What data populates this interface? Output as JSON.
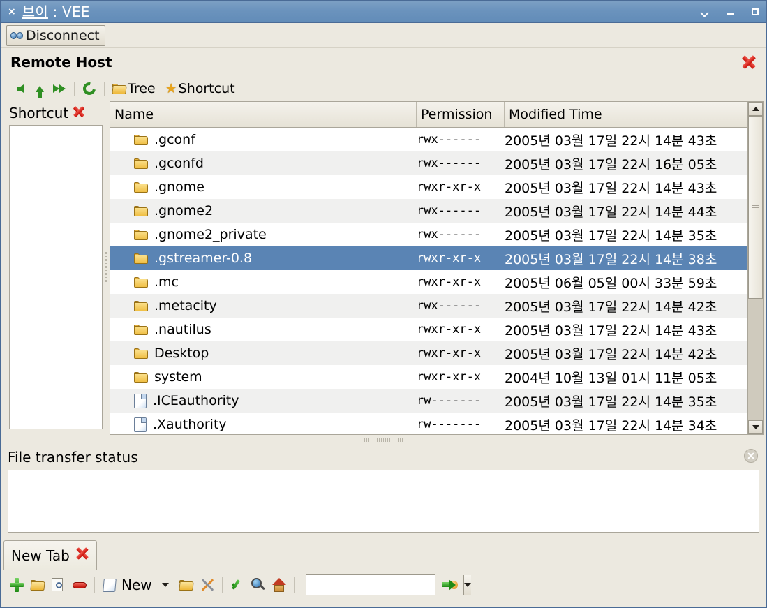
{
  "window": {
    "title_mnemonic": "브이",
    "title_rest": " : VEE",
    "close_glyph": "×",
    "controls": {
      "menu": "chevron-down",
      "minimize": "minimize",
      "maximize": "maximize"
    }
  },
  "toolbar": {
    "disconnect_label": "Disconnect"
  },
  "remote_host": {
    "title": "Remote Host"
  },
  "navbar": {
    "back": "back-arrow",
    "up": "up-arrow",
    "forward": "forward-double-arrow",
    "refresh": "refresh-arrows",
    "tree_label": "Tree",
    "shortcut_label": "Shortcut"
  },
  "shortcut_pane": {
    "title": "Shortcut",
    "items": []
  },
  "file_list": {
    "columns": [
      "Name",
      "Permission",
      "Modified Time"
    ],
    "selected_index": 5,
    "rows": [
      {
        "name": ".gconf",
        "type": "folder",
        "permission": "rwx------",
        "modified": "2005년 03월 17일 22시 14분 43초"
      },
      {
        "name": ".gconfd",
        "type": "folder",
        "permission": "rwx------",
        "modified": "2005년 03월 17일 22시 16분 05초"
      },
      {
        "name": ".gnome",
        "type": "folder",
        "permission": "rwxr-xr-x",
        "modified": "2005년 03월 17일 22시 14분 43초"
      },
      {
        "name": ".gnome2",
        "type": "folder",
        "permission": "rwx------",
        "modified": "2005년 03월 17일 22시 14분 44초"
      },
      {
        "name": ".gnome2_private",
        "type": "folder",
        "permission": "rwx------",
        "modified": "2005년 03월 17일 22시 14분 35초"
      },
      {
        "name": ".gstreamer-0.8",
        "type": "folder",
        "permission": "rwxr-xr-x",
        "modified": "2005년 03월 17일 22시 14분 38초"
      },
      {
        "name": ".mc",
        "type": "folder",
        "permission": "rwxr-xr-x",
        "modified": "2005년 06월 05일 00시 33분 59초"
      },
      {
        "name": ".metacity",
        "type": "folder",
        "permission": "rwx------",
        "modified": "2005년 03월 17일 22시 14분 42초"
      },
      {
        "name": ".nautilus",
        "type": "folder",
        "permission": "rwxr-xr-x",
        "modified": "2005년 03월 17일 22시 14분 43초"
      },
      {
        "name": "Desktop",
        "type": "folder",
        "permission": "rwxr-xr-x",
        "modified": "2005년 03월 17일 22시 14분 42초"
      },
      {
        "name": "system",
        "type": "folder",
        "permission": "rwxr-xr-x",
        "modified": "2004년 10월 13일 01시 11분 05초"
      },
      {
        "name": ".ICEauthority",
        "type": "file",
        "permission": "rw-------",
        "modified": "2005년 03월 17일 22시 14분 35초"
      },
      {
        "name": ".Xauthority",
        "type": "file",
        "permission": "rw-------",
        "modified": "2005년 03월 17일 22시 14분 34초"
      }
    ]
  },
  "status_panel": {
    "title": "File transfer status",
    "content": ""
  },
  "tabs": [
    {
      "label": "New Tab",
      "close_icon": "close-x-icon"
    }
  ],
  "bottom_toolbar": {
    "add": "add-plus-icon",
    "open_folder": "open-folder-icon",
    "preview": "page-search-icon",
    "remove": "remove-minus-icon",
    "new_label": "New",
    "new_doc": "document-icon",
    "new_dropdown": "chevron-down-icon",
    "folder": "folder-icon",
    "tools": "tools-icon",
    "confirm": "check-icon",
    "search_web": "globe-search-icon",
    "home": "home-icon",
    "command_value": "",
    "command_placeholder": "",
    "combo_arrow": "chevron-down-icon",
    "go": "go-arrow-icon"
  },
  "scrollbar": {
    "up": "scroll-up-arrow",
    "down": "scroll-down-arrow",
    "thumb_pct": 60
  },
  "colors": {
    "titlebar": "#6b93bd",
    "selection": "#5a84b4",
    "face": "#ece9e0",
    "row_alt": "#f0f0ef",
    "accent_red": "#c81008",
    "accent_green": "#1f8a14"
  }
}
